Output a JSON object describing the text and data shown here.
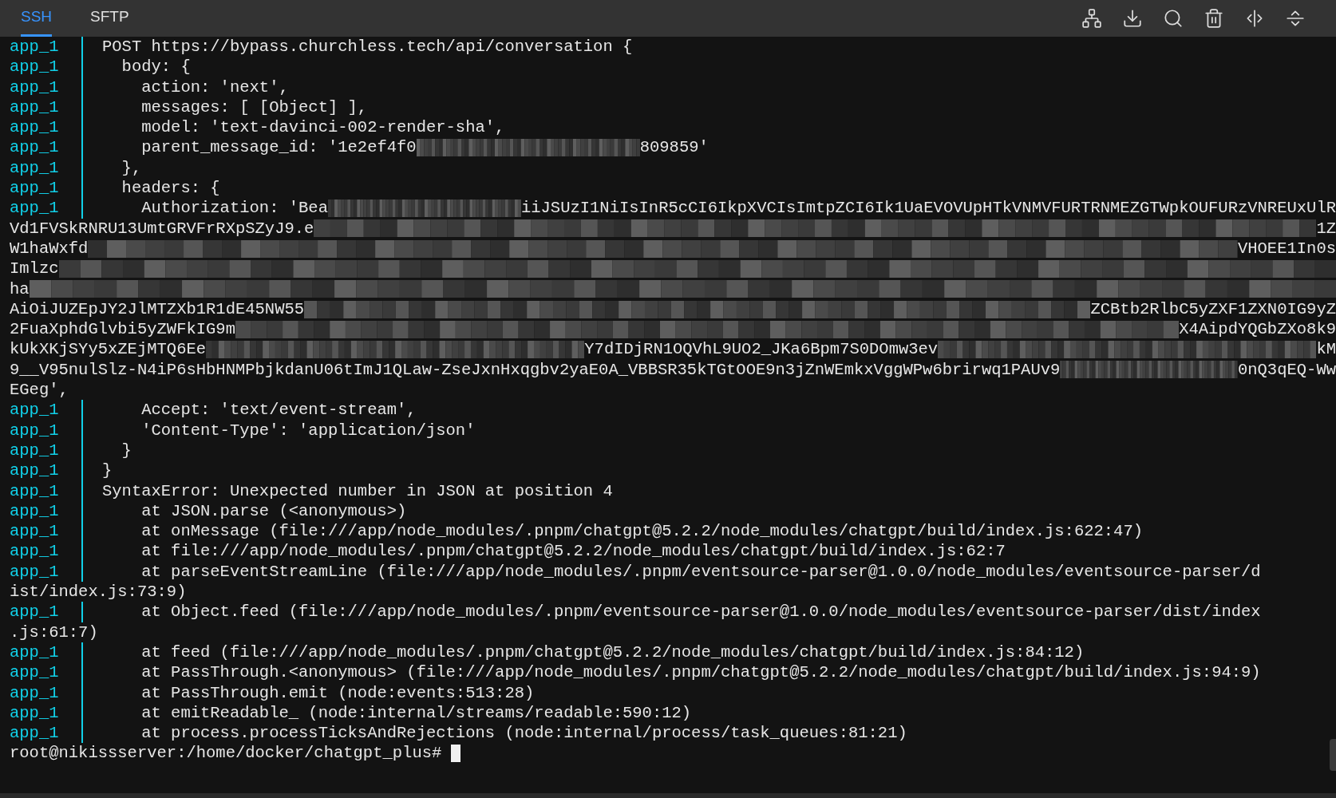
{
  "tabs": [
    {
      "label": "SSH",
      "selected": true
    },
    {
      "label": "SFTP",
      "selected": false
    }
  ],
  "lines": [
    {
      "prefix": "app_1",
      "segments": [
        {
          "kind": "text",
          "text": "POST https://bypass.churchless.tech/api/conversation {"
        }
      ]
    },
    {
      "prefix": "app_1",
      "segments": [
        {
          "kind": "text",
          "text": "  body: {"
        }
      ]
    },
    {
      "prefix": "app_1",
      "segments": [
        {
          "kind": "text",
          "text": "    action: 'next',"
        }
      ]
    },
    {
      "prefix": "app_1",
      "segments": [
        {
          "kind": "text",
          "text": "    messages: [ [Object] ],"
        }
      ]
    },
    {
      "prefix": "app_1",
      "segments": [
        {
          "kind": "text",
          "text": "    model: 'text-davinci-002-render-sha',"
        }
      ]
    },
    {
      "prefix": "app_1",
      "segments": [
        {
          "kind": "text",
          "text": "    parent_message_id: '1e2ef4f0"
        },
        {
          "kind": "redacted"
        },
        {
          "kind": "text",
          "text": "809859'"
        }
      ]
    },
    {
      "prefix": "app_1",
      "segments": [
        {
          "kind": "text",
          "text": "  },"
        }
      ]
    },
    {
      "prefix": "app_1",
      "segments": [
        {
          "kind": "text",
          "text": "  headers: {"
        }
      ]
    },
    {
      "prefix": "app_1",
      "segments": [
        {
          "kind": "text",
          "text": "    Authorization: 'Bea"
        },
        {
          "kind": "redacted"
        },
        {
          "kind": "text",
          "text": "iiJSUzI1NiIsInR5cCI6IkpXVCIsImtpZCI6Ik1UaEVOVUpHTkVNMVFURTRNMEZGTWpkOUFURzVNREUxUlR"
        }
      ]
    },
    {
      "segments": [
        {
          "kind": "text",
          "text": "Vd1FVSkRNRU13UmtGRVFrRXpSZyJ9.e"
        },
        {
          "kind": "redacted"
        },
        {
          "kind": "text",
          "text": "1Z"
        }
      ]
    },
    {
      "segments": [
        {
          "kind": "text",
          "text": "W1haWxfd"
        },
        {
          "kind": "redacted"
        },
        {
          "kind": "text",
          "text": "VHOEE1In0s"
        }
      ]
    },
    {
      "segments": [
        {
          "kind": "text",
          "text": "Imlzc"
        },
        {
          "kind": "redacted"
        }
      ]
    },
    {
      "segments": [
        {
          "kind": "text",
          "text": "ha"
        },
        {
          "kind": "redacted"
        }
      ]
    },
    {
      "segments": [
        {
          "kind": "text",
          "text": "AiOiJUZEpJY2JlMTZXb1R1dE45NW55"
        },
        {
          "kind": "redacted"
        },
        {
          "kind": "text",
          "text": "ZCBtb2RlbC5yZXF1ZXN0IG9yZ"
        }
      ]
    },
    {
      "segments": [
        {
          "kind": "text",
          "text": "2FuaXphdGlvbi5yZWFkIG9m"
        },
        {
          "kind": "redacted"
        },
        {
          "kind": "text",
          "text": "X4AipdYQGbZXo8k9"
        }
      ]
    },
    {
      "segments": [
        {
          "kind": "text",
          "text": "kUkXKjSYy5xZEjMTQ6Ee"
        },
        {
          "kind": "redacted"
        },
        {
          "kind": "text",
          "text": "Y7dIDjRN1OQVhL9UO2_JKa6Bpm7S0DOmw3ev"
        },
        {
          "kind": "redacted"
        },
        {
          "kind": "text",
          "text": "kM"
        }
      ]
    },
    {
      "segments": [
        {
          "kind": "text",
          "text": "9__V95nulSlz-N4iP6sHbHNMPbjkdanU06tImJ1QLaw-ZseJxnHxqgbv2yaE0A_VBBSR35kTGtOOE9n3jZnWEmkxVggWPw6brirwq1PAUv9"
        },
        {
          "kind": "redacted"
        },
        {
          "kind": "text",
          "text": "0nQ3qEQ-Ww"
        }
      ]
    },
    {
      "segments": [
        {
          "kind": "text",
          "text": "EGeg',"
        }
      ]
    },
    {
      "prefix": "app_1",
      "segments": [
        {
          "kind": "text",
          "text": "    Accept: 'text/event-stream',"
        }
      ]
    },
    {
      "prefix": "app_1",
      "segments": [
        {
          "kind": "text",
          "text": "    'Content-Type': 'application/json'"
        }
      ]
    },
    {
      "prefix": "app_1",
      "segments": [
        {
          "kind": "text",
          "text": "  }"
        }
      ]
    },
    {
      "prefix": "app_1",
      "segments": [
        {
          "kind": "text",
          "text": "}"
        }
      ]
    },
    {
      "prefix": "app_1",
      "segments": [
        {
          "kind": "text",
          "text": "SyntaxError: Unexpected number in JSON at position 4"
        }
      ]
    },
    {
      "prefix": "app_1",
      "segments": [
        {
          "kind": "text",
          "text": "    at JSON.parse (<anonymous>)"
        }
      ]
    },
    {
      "prefix": "app_1",
      "segments": [
        {
          "kind": "text",
          "text": "    at onMessage (file:///app/node_modules/.pnpm/chatgpt@5.2.2/node_modules/chatgpt/build/index.js:622:47)"
        }
      ]
    },
    {
      "prefix": "app_1",
      "segments": [
        {
          "kind": "text",
          "text": "    at file:///app/node_modules/.pnpm/chatgpt@5.2.2/node_modules/chatgpt/build/index.js:62:7"
        }
      ]
    },
    {
      "prefix": "app_1",
      "segments": [
        {
          "kind": "text",
          "text": "    at parseEventStreamLine (file:///app/node_modules/.pnpm/eventsource-parser@1.0.0/node_modules/eventsource-parser/d"
        }
      ]
    },
    {
      "segments": [
        {
          "kind": "text",
          "text": "ist/index.js:73:9)"
        }
      ]
    },
    {
      "prefix": "app_1",
      "segments": [
        {
          "kind": "text",
          "text": "    at Object.feed (file:///app/node_modules/.pnpm/eventsource-parser@1.0.0/node_modules/eventsource-parser/dist/index"
        }
      ]
    },
    {
      "segments": [
        {
          "kind": "text",
          "text": ".js:61:7)"
        }
      ]
    },
    {
      "prefix": "app_1",
      "segments": [
        {
          "kind": "text",
          "text": "    at feed (file:///app/node_modules/.pnpm/chatgpt@5.2.2/node_modules/chatgpt/build/index.js:84:12)"
        }
      ]
    },
    {
      "prefix": "app_1",
      "segments": [
        {
          "kind": "text",
          "text": "    at PassThrough.<anonymous> (file:///app/node_modules/.pnpm/chatgpt@5.2.2/node_modules/chatgpt/build/index.js:94:9)"
        }
      ]
    },
    {
      "prefix": "app_1",
      "segments": [
        {
          "kind": "text",
          "text": "    at PassThrough.emit (node:events:513:28)"
        }
      ]
    },
    {
      "prefix": "app_1",
      "segments": [
        {
          "kind": "text",
          "text": "    at emitReadable_ (node:internal/streams/readable:590:12)"
        }
      ]
    },
    {
      "prefix": "app_1",
      "segments": [
        {
          "kind": "text",
          "text": "    at process.processTicksAndRejections (node:internal/process/task_queues:81:21)"
        }
      ]
    }
  ],
  "prompt": "root@nikissserver:/home/docker/chatgpt_plus#"
}
